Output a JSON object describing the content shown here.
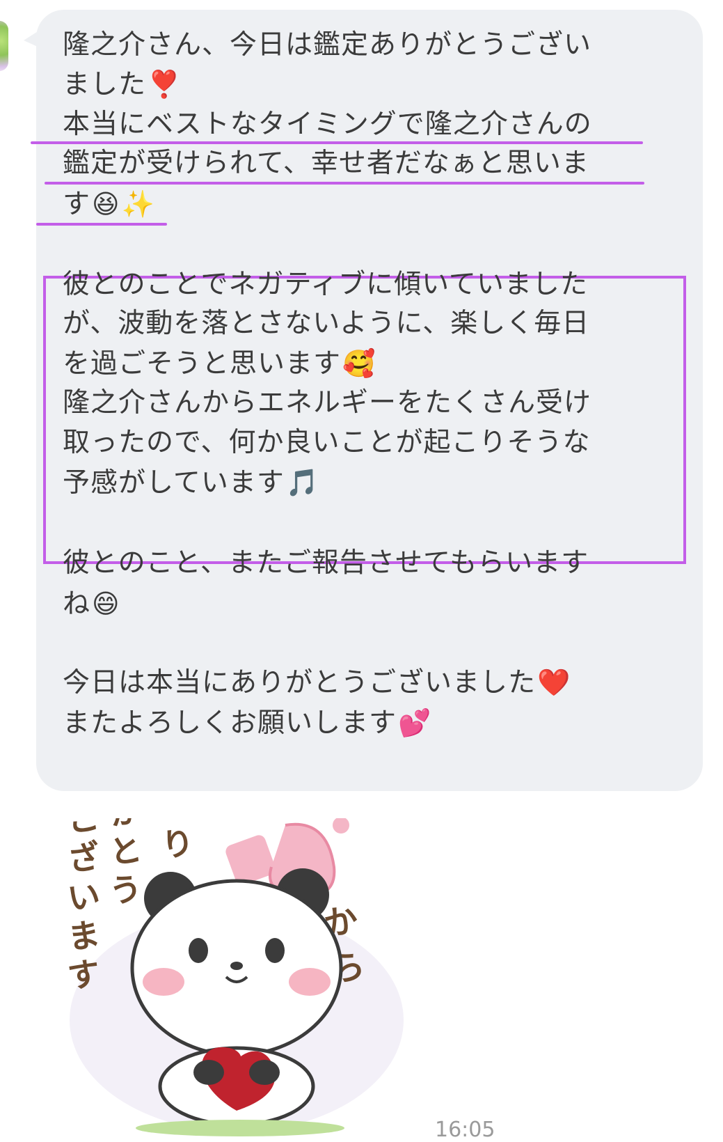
{
  "message": {
    "lines": [
      "隆之介さん、今日は鑑定ありがとうござい",
      "ました",
      "本当にベストなタイミングで隆之介さんの",
      "鑑定が受けられて、幸せ者だなぁと思いま",
      "す",
      "彼とのことでネガティブに傾いていました",
      "が、波動を落とさないように、楽しく毎日",
      "を過ごそうと思います",
      "隆之介さんからエネルギーをたくさん受け",
      "取ったので、何か良いことが起こりそうな",
      "予感がしています",
      "彼とのこと、またご報告させてもらいます",
      "ね",
      "今日は本当にありがとうございました",
      "またよろしくお願いします"
    ],
    "emojis": {
      "exclamation": "❣️",
      "laugh": "😆",
      "sparkles": "✨",
      "smiling_hearts": "🥰",
      "music": "🎵",
      "grin": "😄",
      "heart": "❤️",
      "two_hearts": "💕"
    }
  },
  "sticker": {
    "text_left": "ありがとうございます",
    "text_heart": "心",
    "text_right": "から"
  },
  "timestamp": "16:05",
  "colors": {
    "bubble": "#eef0f3",
    "highlight": "#c35ee8",
    "text": "#3b3b3b"
  }
}
